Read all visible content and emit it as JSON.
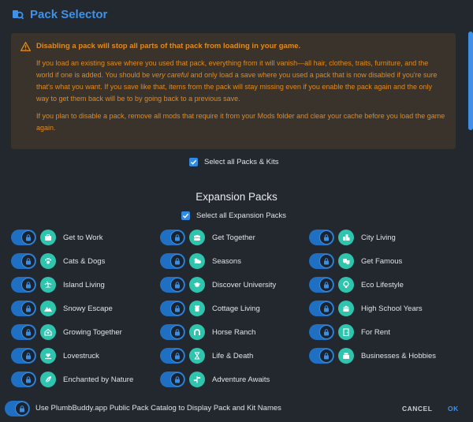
{
  "window": {
    "title": "Pack Selector"
  },
  "warning": {
    "heading": "Disabling a pack will stop all parts of that pack from loading in your game.",
    "p1_a": "If you load an existing save where you used that pack, everything from it will vanish—all hair, clothes, traits, furniture, and the world if one is added. You should be ",
    "p1_em": "very careful",
    "p1_b": " and only load a save where you used a pack that is now disabled if you're sure that's what you want. If you save like that, items from the pack will stay missing even if you enable the pack again and the only way to get them back will be to by going back to a previous save.",
    "p2": "If you plan to disable a pack, remove all mods that require it from your Mods folder and clear your cache before you load the game again."
  },
  "select_all": {
    "label": "Select all Packs & Kits",
    "checked": true
  },
  "expansion": {
    "title": "Expansion Packs",
    "select_all_label": "Select all Expansion Packs",
    "packs": [
      {
        "name": "Get to Work",
        "icon": "briefcase-icon",
        "enabled": true
      },
      {
        "name": "Get Together",
        "icon": "group-icon",
        "enabled": true
      },
      {
        "name": "City Living",
        "icon": "city-icon",
        "enabled": true
      },
      {
        "name": "Cats & Dogs",
        "icon": "paw-icon",
        "enabled": true
      },
      {
        "name": "Seasons",
        "icon": "weather-icon",
        "enabled": true
      },
      {
        "name": "Get Famous",
        "icon": "theater-icon",
        "enabled": true
      },
      {
        "name": "Island Living",
        "icon": "island-icon",
        "enabled": true
      },
      {
        "name": "Discover University",
        "icon": "graduation-cap-icon",
        "enabled": true
      },
      {
        "name": "Eco Lifestyle",
        "icon": "lightbulb-icon",
        "enabled": true
      },
      {
        "name": "Snowy Escape",
        "icon": "mountain-icon",
        "enabled": true
      },
      {
        "name": "Cottage Living",
        "icon": "jar-icon",
        "enabled": true
      },
      {
        "name": "High School Years",
        "icon": "school-icon",
        "enabled": true
      },
      {
        "name": "Growing Together",
        "icon": "house-heart-icon",
        "enabled": true
      },
      {
        "name": "Horse Ranch",
        "icon": "horseshoe-icon",
        "enabled": true
      },
      {
        "name": "For Rent",
        "icon": "door-icon",
        "enabled": true
      },
      {
        "name": "Lovestruck",
        "icon": "heart-hand-icon",
        "enabled": true
      },
      {
        "name": "Life & Death",
        "icon": "hourglass-icon",
        "enabled": true
      },
      {
        "name": "Businesses & Hobbies",
        "icon": "register-icon",
        "enabled": true
      },
      {
        "name": "Enchanted by Nature",
        "icon": "leaf-icon",
        "enabled": true
      },
      {
        "name": "Adventure Awaits",
        "icon": "signpost-icon",
        "enabled": true
      }
    ]
  },
  "footer": {
    "catalog_label": "Use PlumbBuddy.app Public Pack Catalog to Display Pack and Kit Names",
    "cancel_label": "CANCEL",
    "ok_label": "OK"
  },
  "colors": {
    "accent": "#3f92e8",
    "warning": "#e08a1e",
    "icon_bg": "#2fc4ae"
  }
}
